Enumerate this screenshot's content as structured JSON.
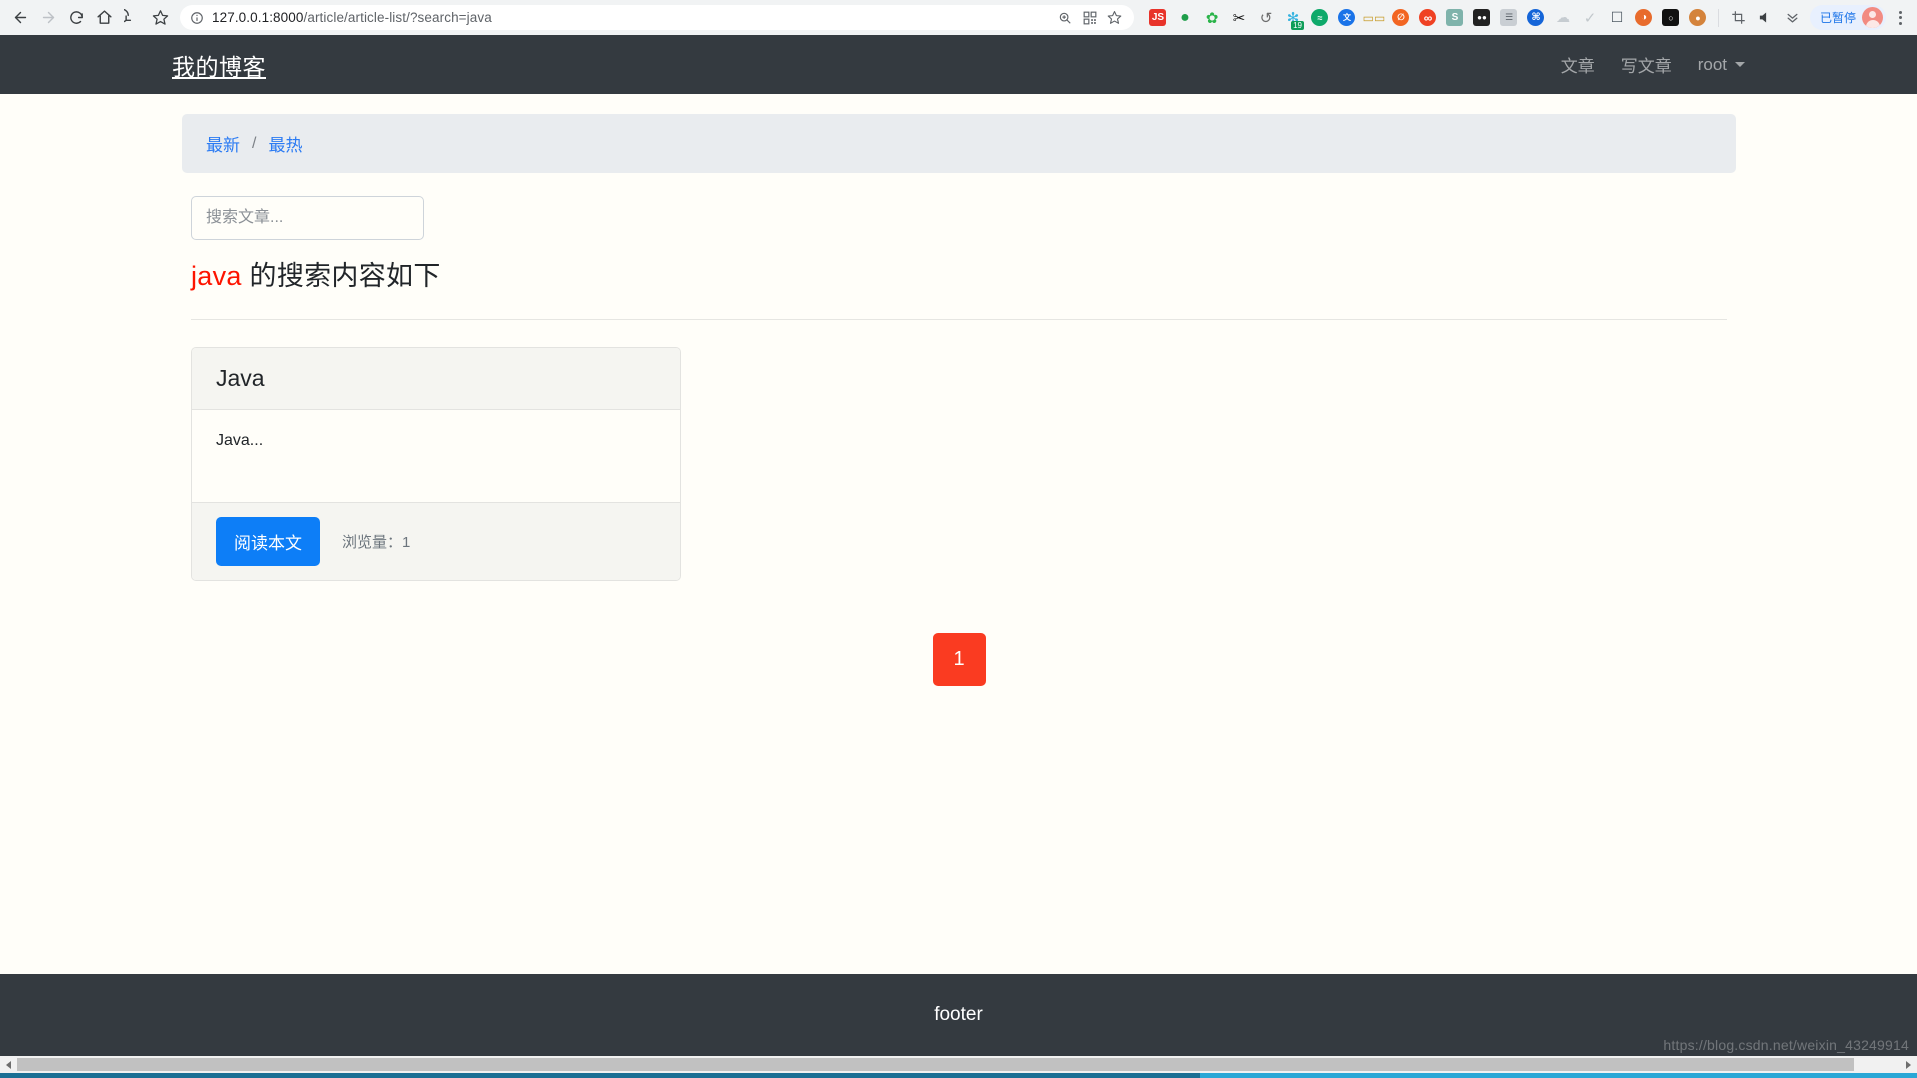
{
  "browser": {
    "back_label": "Back",
    "forward_label": "Forward",
    "reload_label": "Reload",
    "home_label": "Home",
    "undo_label": "Undo",
    "bookmark_label": "Bookmark",
    "url_host": "127.0.0.1:8000",
    "url_path": "/article/article-list/?search=java",
    "url_full": "127.0.0.1:8000/article/article-list/?search=java",
    "omnibox_actions": [
      "zoom-icon",
      "qr-code-icon",
      "star-icon"
    ],
    "extensions": [
      {
        "name": "javascript-toggle-extension",
        "glyph": "JS",
        "color": "#e8332a",
        "shape": "square"
      },
      {
        "name": "internet-download-manager-extension",
        "glyph": "◆",
        "color": "#1f9e4a",
        "shape": "round"
      },
      {
        "name": "baidu-extension",
        "glyph": "✿",
        "color": "#2bb44a",
        "shape": "plain"
      },
      {
        "name": "screenshot-scissors-extension",
        "glyph": "✂",
        "color": "#111111",
        "shape": "plain"
      },
      {
        "name": "history-undo-extension",
        "glyph": "↺",
        "color": "#6d6d6d",
        "shape": "plain"
      },
      {
        "name": "tab-manager-extension",
        "glyph": "✻",
        "color": "#35b2e0",
        "shape": "plain",
        "badge": "19"
      },
      {
        "name": "audio-capture-extension",
        "glyph": "≈",
        "color": "#0ea96a",
        "shape": "round"
      },
      {
        "name": "translate-extension",
        "glyph": "文",
        "color": "#1a73e8",
        "shape": "round"
      },
      {
        "name": "reader-glasses-extension",
        "glyph": "▭▭",
        "color": "#c89c2a",
        "shape": "plain"
      },
      {
        "name": "adblock-extension",
        "glyph": "⊘",
        "color": "#f26522",
        "shape": "round"
      },
      {
        "name": "infinity-extension",
        "glyph": "∞",
        "color": "#ef4123",
        "shape": "round"
      },
      {
        "name": "evernote-extension",
        "glyph": "S",
        "color": "#7fb3ab",
        "shape": "square"
      },
      {
        "name": "dark-mode-extension",
        "glyph": "●●",
        "color": "#222222",
        "shape": "square"
      },
      {
        "name": "kindle-clipper-extension",
        "glyph": "☰",
        "color": "#9aa5ad",
        "shape": "square"
      },
      {
        "name": "proxy-switch-extension",
        "glyph": "⌘",
        "color": "#1565d8",
        "shape": "round"
      },
      {
        "name": "cloud-sync-extension",
        "glyph": "☁",
        "color": "#c6ccd1",
        "shape": "plain"
      },
      {
        "name": "checkmark-extension",
        "glyph": "✓",
        "color": "#c2c8cc",
        "shape": "plain"
      },
      {
        "name": "window-tabs-extension",
        "glyph": "❐",
        "color": "#4f5a63",
        "shape": "plain"
      },
      {
        "name": "firefox-account-extension",
        "glyph": "◕",
        "color": "#e86b2c",
        "shape": "round"
      },
      {
        "name": "mask-avatar-extension",
        "glyph": "○",
        "color": "#111111",
        "shape": "square"
      },
      {
        "name": "monkey-avatar-extension",
        "glyph": "●",
        "color": "#d4833b",
        "shape": "round"
      }
    ],
    "toolbar_tail": [
      {
        "name": "crop-capture-icon",
        "glyph": "⌐"
      },
      {
        "name": "mute-speaker-icon",
        "glyph": "◀"
      },
      {
        "name": "overflow-chevrons-icon",
        "glyph": "»"
      }
    ],
    "paused_chip_label": "已暂停",
    "profile_label": "Profile",
    "menu_label": "Customize and control"
  },
  "navbar": {
    "brand": "我的博客",
    "links": [
      {
        "name": "nav-link-articles",
        "label": "文章"
      },
      {
        "name": "nav-link-write",
        "label": "写文章"
      }
    ],
    "user": "root",
    "caret": "chevron-down-icon"
  },
  "breadcrumb": {
    "items": [
      {
        "label": "最新"
      },
      {
        "label": "最热"
      }
    ],
    "separator": "/"
  },
  "search": {
    "placeholder": "搜索文章...",
    "value": "",
    "keyword": "java",
    "heading_suffix": " 的搜索内容如下"
  },
  "articles": [
    {
      "title": "Java",
      "excerpt": "Java...",
      "read_button": "阅读本文",
      "views_label": "浏览量：",
      "views_value": "1"
    }
  ],
  "pagination": {
    "current": "1",
    "pages": [
      "1"
    ]
  },
  "footer": {
    "text": "footer",
    "watermark": "https://blog.csdn.net/weixin_43249914"
  },
  "colors": {
    "navbar_bg": "#343a40",
    "breadcrumb_bg": "#e9ecef",
    "link_blue": "#2b7bf3",
    "keyword_red": "#fd1400",
    "button_blue": "#0d7ef7",
    "pagination_red": "#fa3b21",
    "page_bg": "#fffef9"
  }
}
